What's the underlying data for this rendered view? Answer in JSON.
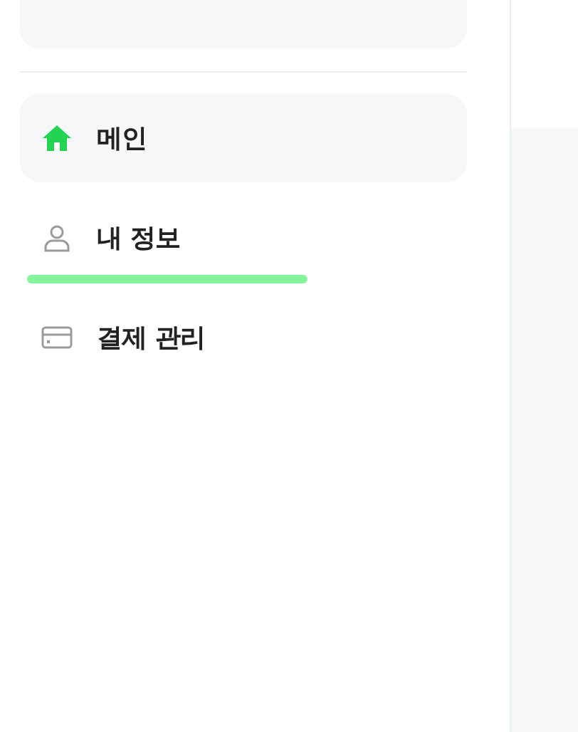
{
  "sidebar": {
    "items": [
      {
        "label": "메인",
        "kind": "home",
        "selected": true,
        "underlined": false
      },
      {
        "label": "내 정보",
        "kind": "user",
        "selected": false,
        "underlined": true
      },
      {
        "label": "결제 관리",
        "kind": "card",
        "selected": false,
        "underlined": false
      }
    ]
  }
}
